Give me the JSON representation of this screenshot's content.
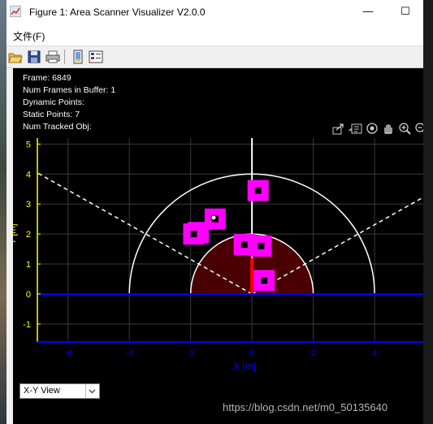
{
  "window": {
    "title": "Figure 1: Area Scanner Visualizer V2.0.0",
    "minimize_glyph": "—",
    "maximize_glyph": "☐"
  },
  "menu": {
    "file": "文件(F)"
  },
  "toolbar": {
    "icons": [
      "folder-open-icon",
      "save-icon",
      "print-icon",
      "window-icon",
      "palette-icon"
    ]
  },
  "info": {
    "frame": "Frame: 6849",
    "num_frames": "Num Frames in Buffer: 1",
    "dynamic_points": "Dynamic Points:",
    "static_points": "Static Points: 7",
    "num_tracked": "Num Tracked Obj:"
  },
  "axes_toolbar": {
    "icons": [
      "export-icon",
      "data-tips-icon",
      "rotate-icon",
      "pan-icon",
      "zoom-in-icon",
      "zoom-out-icon"
    ]
  },
  "view_select": {
    "value": "X-Y View"
  },
  "watermark": "https://blog.csdn.net/m0_50135640",
  "chart_data": {
    "type": "scatter",
    "xlabel": "X [m]",
    "ylabel": "Y [m]",
    "xlim": [
      -7,
      5.8
    ],
    "ylim": [
      -1.6,
      5.2
    ],
    "x_ticks": [
      -6,
      -4,
      -2,
      0,
      2,
      4
    ],
    "y_ticks": [
      -1,
      0,
      1,
      2,
      3,
      4,
      5
    ],
    "grid": true,
    "colors": {
      "background": "#000000",
      "grid": "#3a3a3a",
      "x_axis": "#0000ff",
      "y_axis": "#ffff00",
      "points": "#ff00ff",
      "inner_zone": "#4a0000",
      "range_ring": "#ffffff",
      "sensor_marker": "#ff0000"
    },
    "range_rings": [
      2,
      4
    ],
    "field_of_view_deg": [
      -60,
      60
    ],
    "points": [
      {
        "x": 0.2,
        "y": 3.45
      },
      {
        "x": 0.3,
        "y": 1.6
      },
      {
        "x": 0.4,
        "y": 0.45
      },
      {
        "x": -1.2,
        "y": 2.5
      },
      {
        "x": -1.75,
        "y": 2.05
      },
      {
        "x": -1.9,
        "y": 2.0
      },
      {
        "x": -0.25,
        "y": 1.65
      }
    ],
    "tracked_marker": {
      "x": -1.25,
      "y": 2.55
    }
  }
}
